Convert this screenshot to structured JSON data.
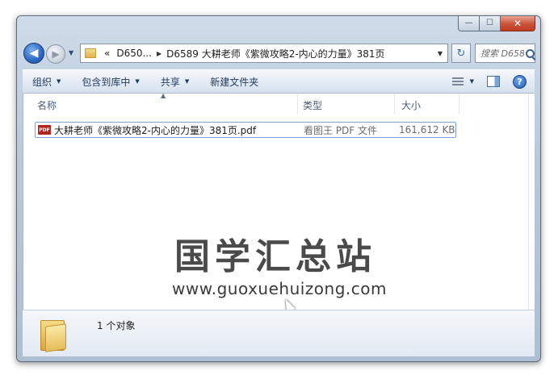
{
  "window": {
    "caption": {
      "minimize": "—",
      "maximize": "☐",
      "close": "✕"
    }
  },
  "nav": {
    "back": "◀",
    "forward": "▶",
    "dropdown": "▼"
  },
  "address": {
    "overflow": "«",
    "crumbs": [
      "D650...",
      "D6589 大耕老师《紫微攻略2-内心的力量》381页"
    ],
    "separator": "▶",
    "dropdown": "▼",
    "refresh": "↻"
  },
  "search": {
    "placeholder": "搜索 D658..."
  },
  "toolbar": {
    "organize": "组织",
    "include_in_library": "包含到库中",
    "share": "共享",
    "new_folder": "新建文件夹",
    "dd": "▼",
    "help": "?"
  },
  "columns": {
    "name": "名称",
    "type": "类型",
    "size": "大小",
    "sort_arrow": "▲"
  },
  "files": [
    {
      "icon": "PDF",
      "name": "大耕老师《紫微攻略2-内心的力量》381页.pdf",
      "type": "看图王 PDF 文件",
      "size": "161,612 KB"
    }
  ],
  "watermark": {
    "title": "国学汇总站",
    "url": "www.guoxuehuizong.com"
  },
  "details": {
    "count": "1 个对象"
  }
}
